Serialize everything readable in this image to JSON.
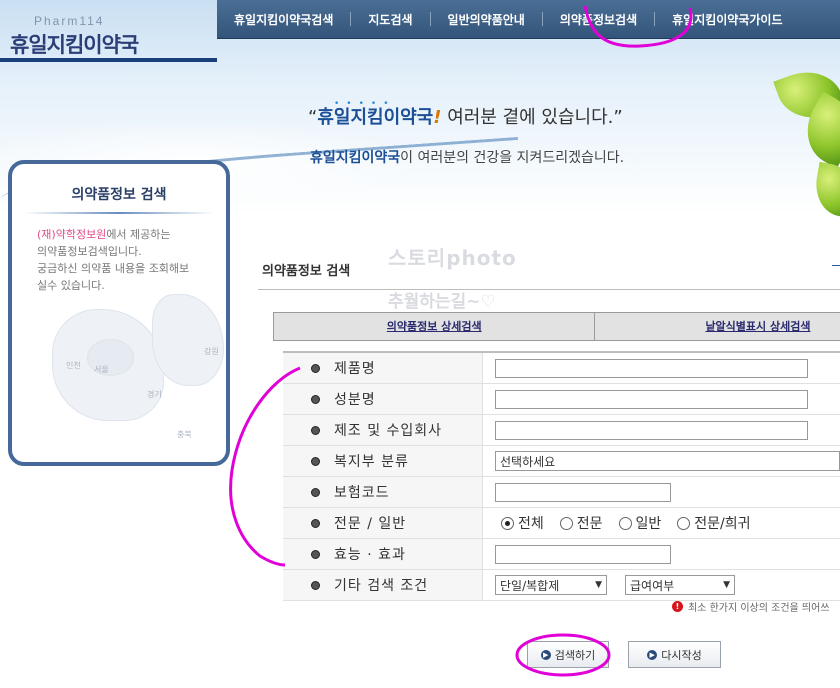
{
  "logo": {
    "sub": "Pharm114",
    "main": "휴일지킴이약국"
  },
  "nav": {
    "items": [
      "휴일지킴이약국검색",
      "지도검색",
      "일반의약품안내",
      "의약품정보검색",
      "휴일지킴이약국가이드"
    ]
  },
  "banner": {
    "slogan_open": "“",
    "slogan_brand": "휴일지킴이약국",
    "slogan_ex": "!",
    "slogan_rest": " 여러분 곁에 있습니다.”",
    "sub_brand": "휴일지킴이약국",
    "sub_rest": "이 여러분의 건강을 지켜드리겠습니다."
  },
  "sidebar": {
    "title": "의약품정보 검색",
    "org": "(재)약학정보원",
    "text1": "에서 제공하는",
    "text2": "의약품정보검색입니다.",
    "text3": "궁금하신 의약품 내용을 조회해보",
    "text4": "실수 있습니다.",
    "map_labels": [
      "인천",
      "서울",
      "강원",
      "경기",
      "충북"
    ]
  },
  "content": {
    "title": "의약품정보 검색",
    "watermark1": "스토리photo",
    "watermark2": "추월하는길~♡"
  },
  "tabs": [
    "의약품정보 상세검색",
    "낱알식별표시 상세검색"
  ],
  "form": {
    "labels": [
      "제품명",
      "성분명",
      "제조 및 수입회사",
      "복지부 분류",
      "보험코드",
      "전문 / 일반",
      "효능 · 효과",
      "기타 검색 조건"
    ],
    "category_select": "선택하세요",
    "radios": [
      "전체",
      "전문",
      "일반",
      "전문/희귀"
    ],
    "radio_selected": "전체",
    "select_mix": "단일/복합제",
    "select_benefit": "급여여부"
  },
  "notice": "최소 한가지 이상의 조건을 띄어쓰",
  "buttons": {
    "search": "검색하기",
    "reset": "다시작성"
  },
  "colors": {
    "nav": "#3d6088",
    "accent": "#1d4f97",
    "annotation": "#e000d8"
  }
}
